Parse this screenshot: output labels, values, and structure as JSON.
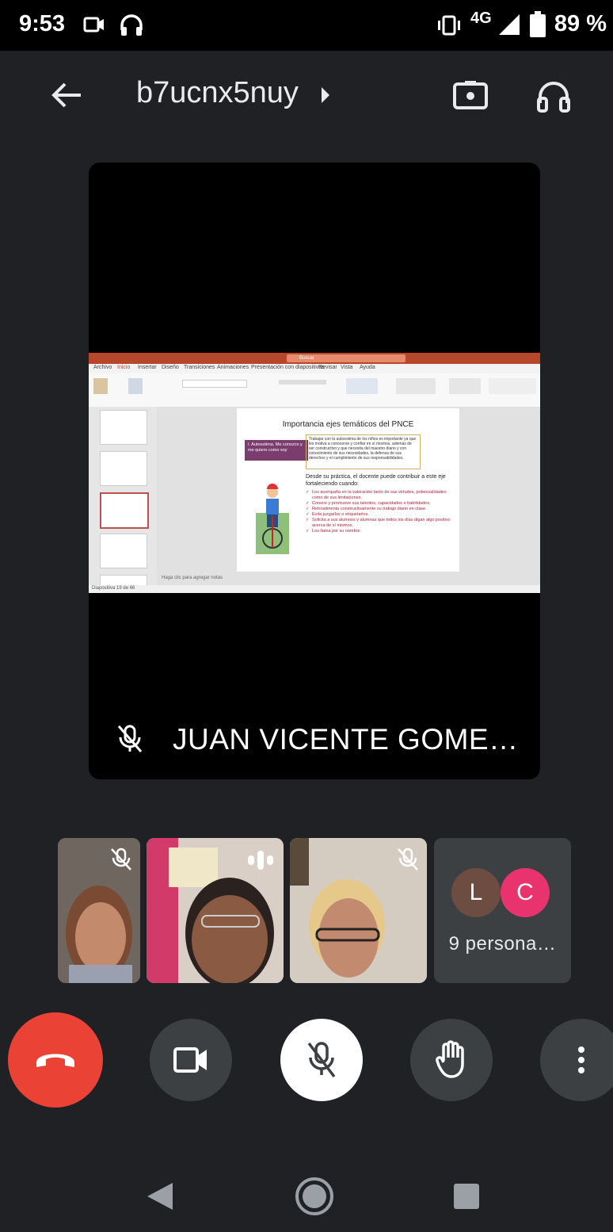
{
  "status_bar": {
    "time": "9:53",
    "network": "4G",
    "battery": "89 %"
  },
  "header": {
    "meeting_code": "b7ucnx5nuy",
    "back_icon": "arrow-left-icon",
    "switch_camera_icon": "switch-camera-icon",
    "audio_output_icon": "headphones-icon"
  },
  "main_stage": {
    "presenter_name": "JUAN VICENTE GOME…",
    "presenter_mic_state": "muted"
  },
  "shared_slide": {
    "title": "Importancia ejes temáticos del PNCE",
    "badge": "I. Autoestima. Me conozco y me quiero como soy",
    "box_text": "Trabajar con la autoestima de los niños es importante ya que les motiva a conocerse y confiar en sí mismos, además de ser constructivo y que necesita del maestro diario y con conocimiento de sus necesidades, la defensa de sus derechos y el cumplimiento de sus responsabilidades.",
    "intro": "Desde su práctica, el docente puede contribuir a este eje fortaleciendo cuando:",
    "bullets": [
      "Los acompaña en la valoración tanto de sus virtudes, potencialidades como de sus limitaciones.",
      "Conoce y promueve sus talentos, capacidades e habilidades.",
      "Retroalimenta constructivamente su trabajo diario en clase.",
      "Evita juzgarlos o etiquetarlos.",
      "Solicita a sus alumnos y alumnas que todos los días digan algo positivo acerca de sí mismos.",
      "Los llama por su nombre."
    ],
    "notes_placeholder": "Haga clic para agregar notas",
    "app_tabs": [
      "Archivo",
      "Inicio",
      "Insertar",
      "Diseño",
      "Transiciones",
      "Animaciones",
      "Presentación con diapositivas",
      "Revisar",
      "Vista",
      "Ayuda"
    ],
    "status_left": "Diapositiva 19 de 66",
    "search_placeholder": "Buscar"
  },
  "participants": {
    "tiles": [
      {
        "name": "participant-1",
        "mic": "muted"
      },
      {
        "name": "participant-2",
        "mic": "speaking"
      },
      {
        "name": "participant-3",
        "mic": "muted"
      }
    ],
    "more": {
      "avatars": [
        {
          "letter": "L",
          "color": "#6d4c41"
        },
        {
          "letter": "C",
          "color": "#e8336e"
        }
      ],
      "label": "9 persona…"
    }
  },
  "controls": {
    "end_call_color": "#ea4335",
    "end_call_icon": "phone-hangup-icon",
    "camera_icon": "video-camera-icon",
    "mic_icon": "mic-off-icon",
    "raise_hand_icon": "hand-icon",
    "more_icon": "more-vert-icon"
  },
  "nav_bar": {
    "back_icon": "nav-back-icon",
    "home_icon": "nav-home-icon",
    "recents_icon": "nav-recents-icon"
  }
}
